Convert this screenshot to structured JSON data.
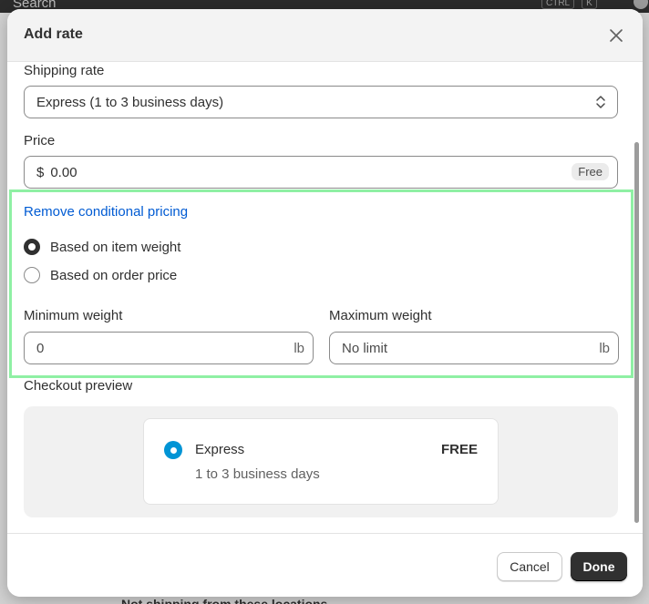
{
  "background": {
    "search_placeholder": "Search",
    "shortcut_keys": [
      "CTRL",
      "K"
    ],
    "bottom_text": "Not shipping from these locations"
  },
  "modal": {
    "title": "Add rate",
    "close_icon": "close-icon"
  },
  "shipping_rate": {
    "label": "Shipping rate",
    "selected": "Express (1 to 3 business days)",
    "chevron_icon": "select-chevron-icon"
  },
  "price": {
    "label": "Price",
    "currency_symbol": "$",
    "value": "0.00",
    "badge": "Free"
  },
  "conditional": {
    "remove_link": "Remove conditional pricing",
    "options": [
      {
        "label": "Based on item weight",
        "checked": true
      },
      {
        "label": "Based on order price",
        "checked": false
      }
    ],
    "min_weight": {
      "label": "Minimum weight",
      "value": "0",
      "unit": "lb"
    },
    "max_weight": {
      "label": "Maximum weight",
      "placeholder": "No limit",
      "unit": "lb"
    },
    "highlight_color": "#8ff0a4"
  },
  "checkout_preview": {
    "label": "Checkout preview",
    "name": "Express",
    "price": "FREE",
    "subtitle": "1 to 3 business days",
    "radio_color": "#0094d5"
  },
  "footer": {
    "cancel_label": "Cancel",
    "done_label": "Done"
  }
}
